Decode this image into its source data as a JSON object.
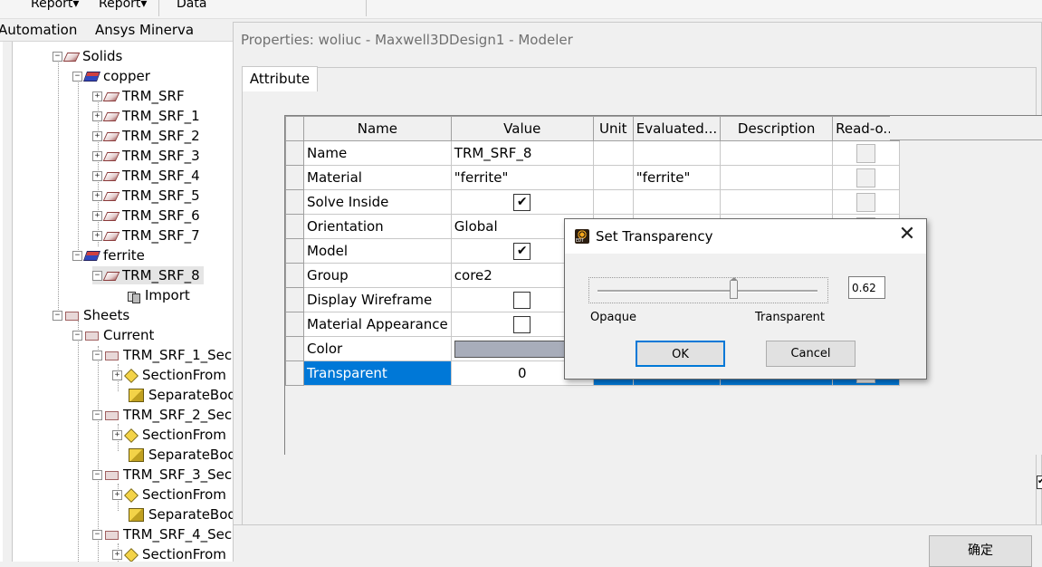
{
  "ribbon": {
    "items": [
      "Report",
      "Report",
      "Data"
    ]
  },
  "menubar": {
    "items": [
      "Automation",
      "Ansys Minerva"
    ]
  },
  "tree": {
    "solids": "Solids",
    "copper": "copper",
    "copper_items": [
      "TRM_SRF",
      "TRM_SRF_1",
      "TRM_SRF_2",
      "TRM_SRF_3",
      "TRM_SRF_4",
      "TRM_SRF_5",
      "TRM_SRF_6",
      "TRM_SRF_7"
    ],
    "ferrite": "ferrite",
    "ferrite_item": "TRM_SRF_8",
    "import": "Import",
    "sheets": "Sheets",
    "current": "Current",
    "sheet_groups": [
      {
        "name": "TRM_SRF_1_Sec",
        "sec": "SectionFrom",
        "sep": "SeparateBod"
      },
      {
        "name": "TRM_SRF_2_Sec",
        "sec": "SectionFrom",
        "sep": "SeparateBod"
      },
      {
        "name": "TRM_SRF_3_Sec",
        "sec": "SectionFrom",
        "sep": "SeparateBod"
      },
      {
        "name": "TRM_SRF_4_Sec",
        "sec": "SectionFrom"
      }
    ]
  },
  "props": {
    "title": "Properties: woliuc - Maxwell3DDesign1 - Modeler",
    "tab": "Attribute",
    "ok_label": "确定",
    "columns": [
      "Name",
      "Value",
      "Unit",
      "Evaluated...",
      "Description",
      "Read-o..."
    ],
    "rows": [
      {
        "name": "Name",
        "value": "TRM_SRF_8",
        "evaluated": "",
        "kind": "text"
      },
      {
        "name": "Material",
        "value": "\"ferrite\"",
        "evaluated": "\"ferrite\"",
        "kind": "text"
      },
      {
        "name": "Solve Inside",
        "value": "",
        "evaluated": "",
        "kind": "check",
        "checked": true
      },
      {
        "name": "Orientation",
        "value": "Global",
        "evaluated": "",
        "kind": "text"
      },
      {
        "name": "Model",
        "value": "",
        "evaluated": "",
        "kind": "check",
        "checked": true
      },
      {
        "name": "Group",
        "value": "core2",
        "evaluated": "",
        "kind": "text"
      },
      {
        "name": "Display Wireframe",
        "value": "",
        "evaluated": "",
        "kind": "check",
        "checked": false
      },
      {
        "name": "Material Appearance",
        "value": "",
        "evaluated": "",
        "kind": "check",
        "checked": false
      },
      {
        "name": "Color",
        "value": "",
        "evaluated": "",
        "kind": "color",
        "color": "#a8adba"
      },
      {
        "name": "Transparent",
        "value": "0",
        "evaluated": "",
        "kind": "selected"
      }
    ]
  },
  "dialog": {
    "title": "Set Transparency",
    "opaque_label": "Opaque",
    "transparent_label": "Transparent",
    "value": "0.62",
    "slider_fraction": 0.62,
    "ok_label": "OK",
    "cancel_label": "Cancel"
  },
  "colors": {
    "selection": "#0078d7",
    "dialog_bg": "#f0f0f0"
  }
}
